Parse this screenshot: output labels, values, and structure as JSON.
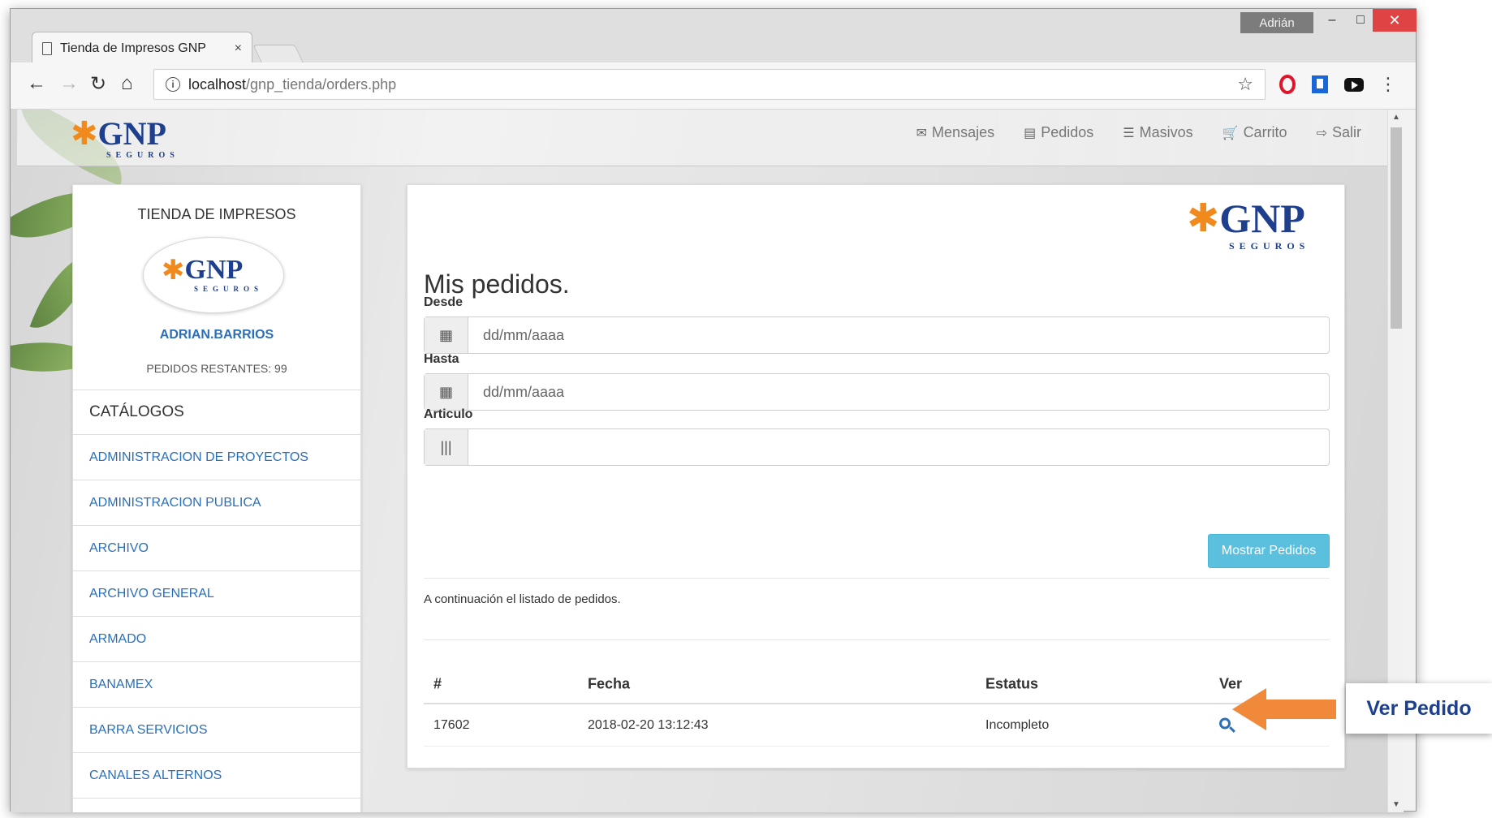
{
  "browser": {
    "tab_title": "Tienda de Impresos GNP",
    "tab_close": "×",
    "user": "Adrián",
    "min": "–",
    "max": "□",
    "close": "✕",
    "url_host": "localhost",
    "url_path": "/gnp_tienda/orders.php",
    "icons": [
      "page-icon",
      "back-icon",
      "forward-icon",
      "reload-icon",
      "home-icon",
      "info-icon",
      "star-icon",
      "opera-icon",
      "bookmark-extension-icon",
      "youtube-icon",
      "menu-icon"
    ]
  },
  "header": {
    "logo": {
      "word": "GNP",
      "sub": "SEGUROS"
    },
    "nav": [
      {
        "label": "Mensajes",
        "icon": "envelope-icon"
      },
      {
        "label": "Pedidos",
        "icon": "list-icon"
      },
      {
        "label": "Masivos",
        "icon": "th-list-icon"
      },
      {
        "label": "Carrito",
        "icon": "cart-icon"
      },
      {
        "label": "Salir",
        "icon": "logout-icon"
      }
    ]
  },
  "sidebar": {
    "store_title": "TIENDA DE IMPRESOS",
    "username": "ADRIAN.BARRIOS",
    "remaining": "PEDIDOS RESTANTES: 99",
    "catalog_header": "CATÁLOGOS",
    "catalogs": [
      "ADMINISTRACION DE PROYECTOS",
      "ADMINISTRACION PUBLICA",
      "ARCHIVO",
      "ARCHIVO GENERAL",
      "ARMADO",
      "BANAMEX",
      "BARRA SERVICIOS",
      "CANALES ALTERNOS"
    ]
  },
  "main": {
    "title": "Mis pedidos.",
    "desde_label": "Desde",
    "desde_placeholder": "dd/mm/aaaa",
    "hasta_label": "Hasta",
    "hasta_placeholder": "dd/mm/aaaa",
    "articulo_label": "Articulo",
    "articulo_value": "",
    "show_button": "Mostrar Pedidos",
    "list_intro": "A continuación el listado de pedidos.",
    "table": {
      "headers": [
        "#",
        "Fecha",
        "Estatus",
        "Ver"
      ],
      "rows": [
        {
          "id": "17602",
          "date": "2018-02-20 13:12:43",
          "status": "Incompleto"
        }
      ]
    }
  },
  "annotation": {
    "label": "Ver Pedido",
    "color": "#f08a3a"
  },
  "colors": {
    "link": "#2a6fba",
    "brand_blue": "#1d3f8e",
    "brand_orange": "#f08a1c",
    "button_info": "#5bc0de"
  }
}
